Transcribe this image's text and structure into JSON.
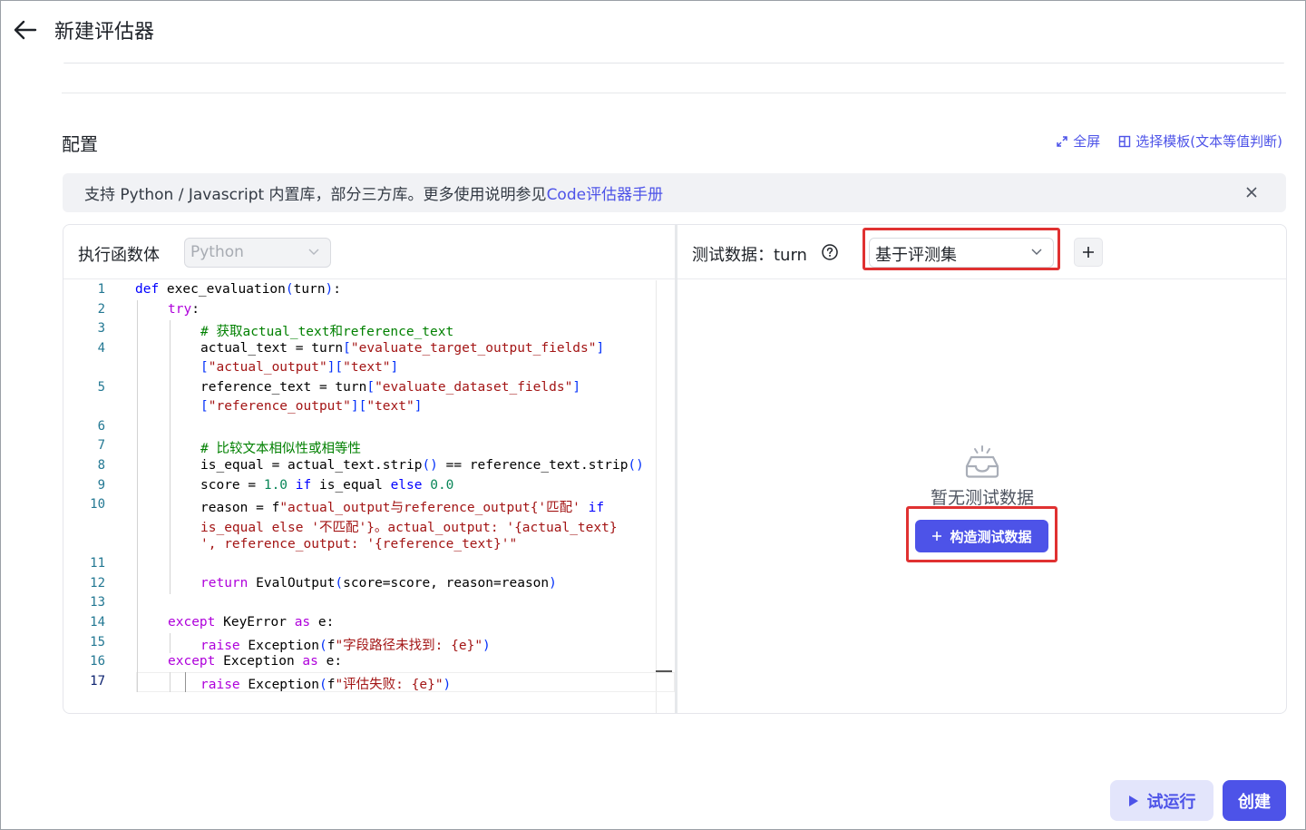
{
  "header": {
    "title": "新建评估器"
  },
  "config": {
    "title": "配置",
    "fullscreen_label": "全屏",
    "template_label": "选择模板(文本等值判断)"
  },
  "info_bar": {
    "text": "支持 Python / Javascript 内置库，部分三方库。更多使用说明参见",
    "link": "Code评估器手册"
  },
  "editor": {
    "label": "执行函数体",
    "language": "Python",
    "active_line": 17
  },
  "test_data": {
    "label": "测试数据：turn",
    "source": "基于评测集",
    "add_label": "+",
    "empty_text": "暂无测试数据",
    "build_label": "构造测试数据"
  },
  "footer": {
    "trial_label": "试运行",
    "create_label": "创建"
  },
  "colors": {
    "accent": "#4d53e8",
    "highlight": "#e03131"
  },
  "icons": [
    "back-arrow-icon",
    "expand-icon",
    "template-icon",
    "close-icon",
    "chevron-down-icon",
    "help-icon",
    "plus-icon",
    "empty-inbox-icon",
    "play-icon"
  ]
}
